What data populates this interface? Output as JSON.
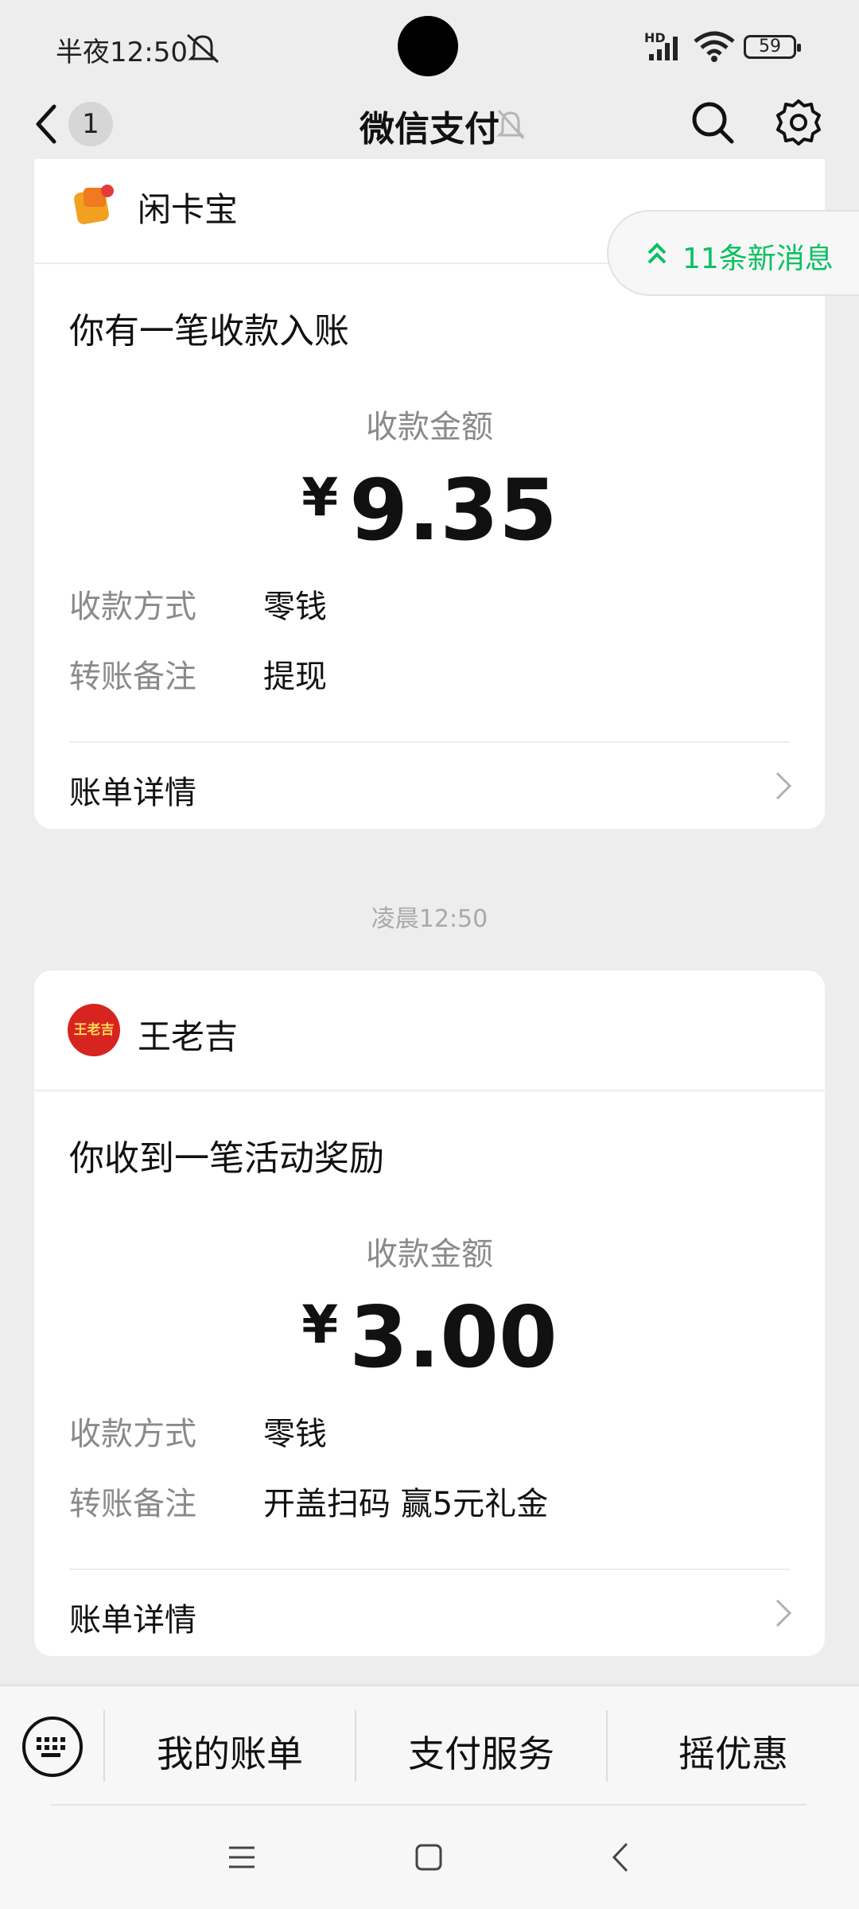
{
  "status_bar": {
    "time": "半夜12:50",
    "battery": "59",
    "network": "HD"
  },
  "nav": {
    "back_count": "1",
    "title": "微信支付"
  },
  "new_messages": {
    "label": "11条新消息"
  },
  "cards": [
    {
      "merchant": "闲卡宝",
      "headline": "你有一笔收款入账",
      "amount_label": "收款金额",
      "currency": "¥",
      "amount": "9.35",
      "rows": [
        {
          "label": "收款方式",
          "value": "零钱"
        },
        {
          "label": "转账备注",
          "value": "提现"
        }
      ],
      "detail_label": "账单详情"
    },
    {
      "merchant": "王老吉",
      "logo_text": "王老吉",
      "headline": "你收到一笔活动奖励",
      "amount_label": "收款金额",
      "currency": "¥",
      "amount": "3.00",
      "rows": [
        {
          "label": "收款方式",
          "value": "零钱"
        },
        {
          "label": "转账备注",
          "value": "开盖扫码 赢5元礼金"
        }
      ],
      "detail_label": "账单详情"
    }
  ],
  "timestamp": "凌晨12:50",
  "menu": {
    "items": [
      "我的账单",
      "支付服务",
      "摇优惠"
    ]
  },
  "icons": [
    "mute-icon",
    "signal-icon",
    "wifi-icon",
    "battery-icon",
    "back-arrow-icon",
    "bell-off-icon",
    "search-icon",
    "gear-icon",
    "double-chevron-up-icon",
    "chevron-right-icon",
    "keyboard-icon",
    "menu-nav-icon",
    "home-nav-icon",
    "back-nav-icon"
  ],
  "colors": {
    "accent": "#07c160",
    "background": "#ededed",
    "card": "#ffffff"
  }
}
